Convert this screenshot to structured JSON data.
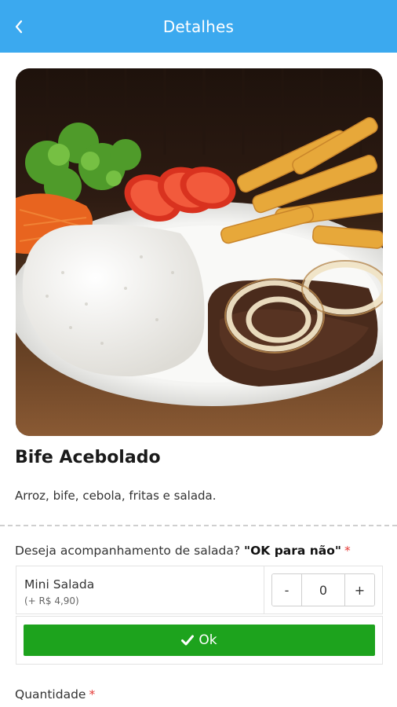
{
  "appbar": {
    "title": "Detalhes",
    "back_icon": "chevron-left-icon"
  },
  "product": {
    "image_alt": "Bife Acebolado",
    "name": "Bife Acebolado",
    "description": "Arroz, bife, cebola, fritas e salada."
  },
  "options": {
    "question_text": "Deseja acompanhamento de salada? ",
    "question_emphasis": "\"OK para não\"",
    "required_mark": "*",
    "items": [
      {
        "name": "Mini Salada",
        "price": "(+ R$ 4,90)",
        "quantity": "0",
        "minus_label": "-",
        "plus_label": "+"
      }
    ],
    "ok_label": "Ok"
  },
  "quantity": {
    "label": "Quantidade",
    "required_mark": "*"
  },
  "colors": {
    "appbar": "#3BA9EF",
    "ok_button": "#1DA31D",
    "required": "#E53935"
  }
}
